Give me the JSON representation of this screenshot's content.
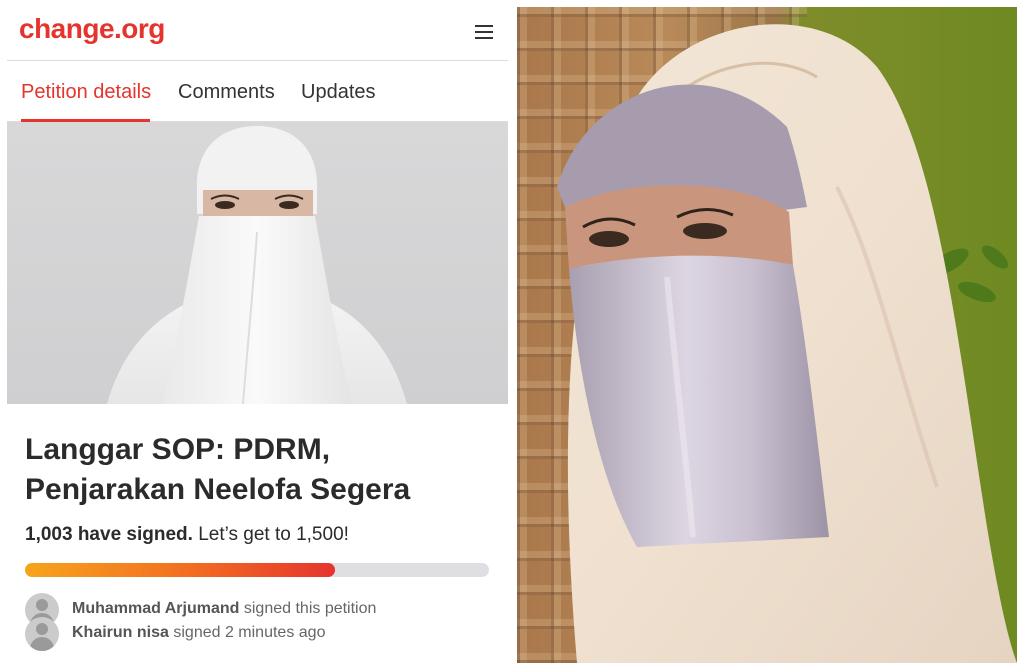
{
  "header": {
    "logo_text": "change.org",
    "menu_icon": "hamburger-menu-icon"
  },
  "tabs": [
    {
      "label": "Petition details",
      "active": true
    },
    {
      "label": "Comments",
      "active": false
    },
    {
      "label": "Updates",
      "active": false
    }
  ],
  "petition": {
    "title": "Langgar SOP: PDRM, Penjarakan Neelofa Segera",
    "signed_count": "1,003 have signed.",
    "goal_text": "Let’s get to 1,500!",
    "progress_fraction": 0.6687
  },
  "signers": [
    {
      "name": "Muhammad Arjumand",
      "action": "signed this petition"
    },
    {
      "name": "Khairun nisa",
      "action": "signed 2 minutes ago"
    }
  ],
  "colors": {
    "brand": "#e5342d",
    "progress_start": "#f7a41c",
    "progress_end": "#e5342d"
  }
}
